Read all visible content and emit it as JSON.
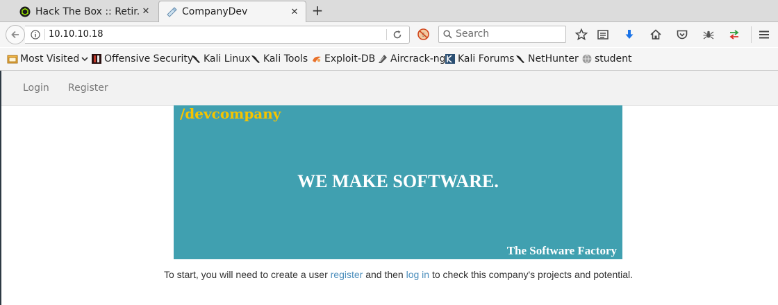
{
  "browser": {
    "tabs": [
      {
        "title": "Hack The Box :: Retir...",
        "close": "✕"
      },
      {
        "title": "CompanyDev",
        "close": "✕"
      }
    ],
    "new_tab": "+",
    "url": "10.10.10.18",
    "search_placeholder": "Search",
    "icons": [
      "back-icon",
      "info-icon",
      "reload-icon",
      "noscript-icon",
      "search-icon",
      "star-icon",
      "reading-list-icon",
      "download-icon",
      "home-icon",
      "pocket-icon",
      "spider-icon",
      "sync-arrows-icon",
      "menu-icon"
    ]
  },
  "bookmarks": [
    {
      "label": "Most Visited",
      "icon": "folder-icon"
    },
    {
      "label": "Offensive Security",
      "icon": "offsec-icon"
    },
    {
      "label": "Kali Linux",
      "icon": "kali-dragon-icon"
    },
    {
      "label": "Kali Tools",
      "icon": "kali-dragon-icon"
    },
    {
      "label": "Exploit-DB",
      "icon": "exploitdb-icon"
    },
    {
      "label": "Aircrack-ng",
      "icon": "aircrack-icon"
    },
    {
      "label": "Kali Forums",
      "icon": "kali-forums-icon"
    },
    {
      "label": "NetHunter",
      "icon": "kali-dragon-icon"
    },
    {
      "label": "student",
      "icon": "globe-icon"
    }
  ],
  "site": {
    "nav": {
      "login": "Login",
      "register": "Register"
    },
    "banner": {
      "brand": "/devcompany",
      "headline": "WE MAKE SOFTWARE.",
      "tagline": "The Software Factory",
      "bg_color": "#40a0b0",
      "brand_color": "#f5c400"
    },
    "caption": {
      "part1": "To start, you will need to create a user ",
      "register_link": "register",
      "part2": " and then ",
      "login_link": "log in",
      "part3": " to check this company's projects and potential."
    }
  }
}
